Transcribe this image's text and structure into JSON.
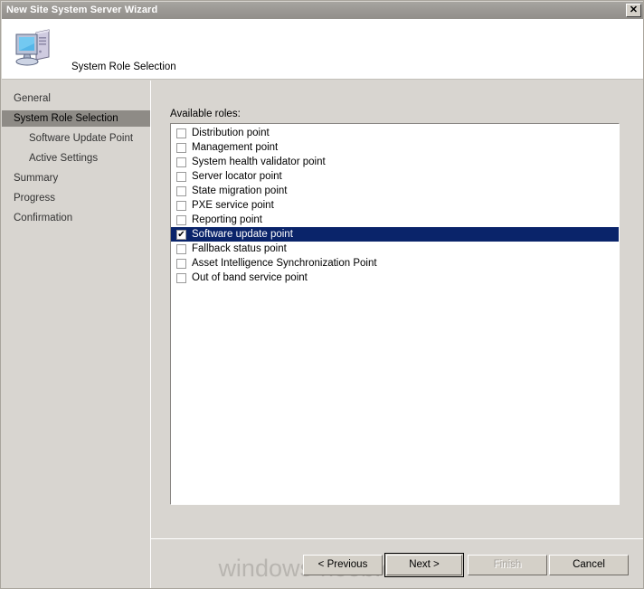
{
  "window": {
    "title": "New Site System Server Wizard",
    "close_label": "✕"
  },
  "header": {
    "icon": "computer-icon",
    "title": "System Role Selection"
  },
  "sidebar": {
    "items": [
      {
        "label": "General",
        "level": 0,
        "active": false
      },
      {
        "label": "System Role Selection",
        "level": 0,
        "active": true
      },
      {
        "label": "Software Update Point",
        "level": 1,
        "active": false
      },
      {
        "label": "Active Settings",
        "level": 1,
        "active": false
      },
      {
        "label": "Summary",
        "level": 0,
        "active": false
      },
      {
        "label": "Progress",
        "level": 0,
        "active": false
      },
      {
        "label": "Confirmation",
        "level": 0,
        "active": false
      }
    ]
  },
  "main": {
    "roles_label": "Available roles:",
    "roles": [
      {
        "label": "Distribution point",
        "checked": false,
        "selected": false
      },
      {
        "label": "Management point",
        "checked": false,
        "selected": false
      },
      {
        "label": "System health validator point",
        "checked": false,
        "selected": false
      },
      {
        "label": "Server locator point",
        "checked": false,
        "selected": false
      },
      {
        "label": "State migration point",
        "checked": false,
        "selected": false
      },
      {
        "label": "PXE service point",
        "checked": false,
        "selected": false
      },
      {
        "label": "Reporting point",
        "checked": false,
        "selected": false
      },
      {
        "label": "Software update point",
        "checked": true,
        "selected": true
      },
      {
        "label": "Fallback status point",
        "checked": false,
        "selected": false
      },
      {
        "label": "Asset Intelligence Synchronization Point",
        "checked": false,
        "selected": false
      },
      {
        "label": "Out of band service point",
        "checked": false,
        "selected": false
      }
    ],
    "check_glyph": "✔"
  },
  "footer": {
    "watermark": "windows-noob.com",
    "buttons": [
      {
        "label": "< Previous",
        "state": "enabled"
      },
      {
        "label": "Next >",
        "state": "default"
      },
      {
        "label": "Finish",
        "state": "disabled"
      },
      {
        "label": "Cancel",
        "state": "enabled"
      }
    ]
  },
  "colors": {
    "dialog_face": "#d8d5d0",
    "titlebar": "#9b9894",
    "selection": "#0a246a",
    "nav_active": "#8e8b86",
    "watermark": "#b8b5b0"
  }
}
